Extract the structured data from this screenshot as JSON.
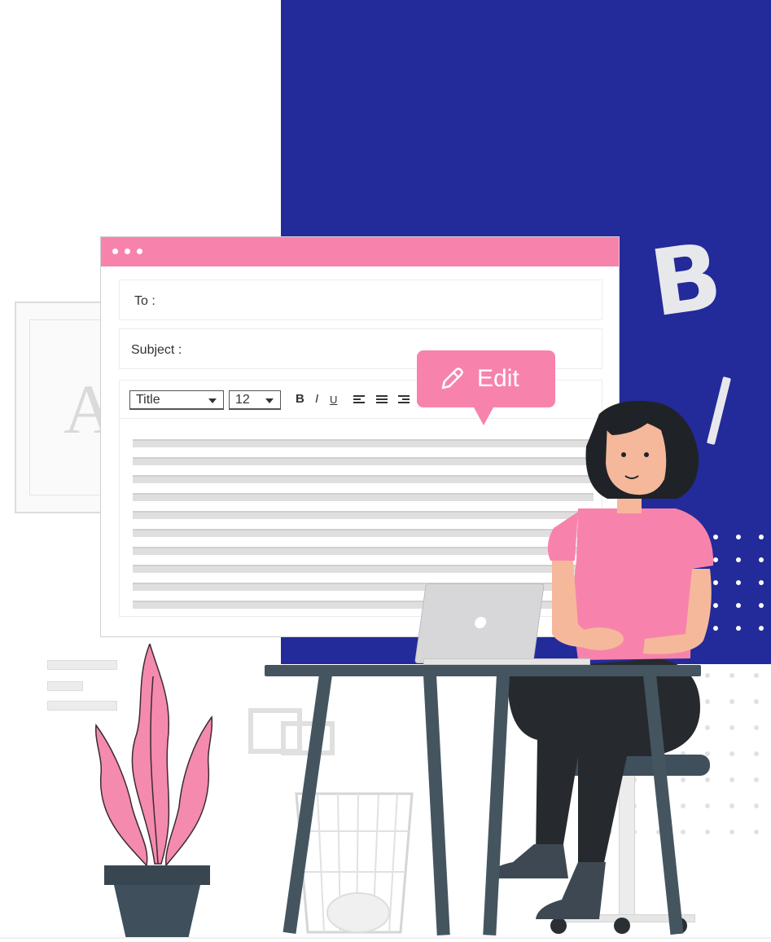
{
  "colors": {
    "panel_blue": "#232a99",
    "accent_pink": "#f783ac",
    "desk_dark": "#455560",
    "skin": "#f6b89a",
    "hair": "#1f2328"
  },
  "editor": {
    "title_bar_icons": [
      "dot",
      "dot",
      "dot"
    ],
    "to_label": "To :",
    "subject_label": "Subject :",
    "toolbar": {
      "style_select": "Title",
      "size_select": "12",
      "bold": "B",
      "italic": "I",
      "underline": "U",
      "align_icons": [
        "align-left-icon",
        "align-center-icon",
        "align-right-icon"
      ]
    }
  },
  "tooltip": {
    "icon": "pencil-icon",
    "label": "Edit"
  },
  "decor": {
    "float_letter_bold": "B",
    "frame_letter": "A"
  }
}
